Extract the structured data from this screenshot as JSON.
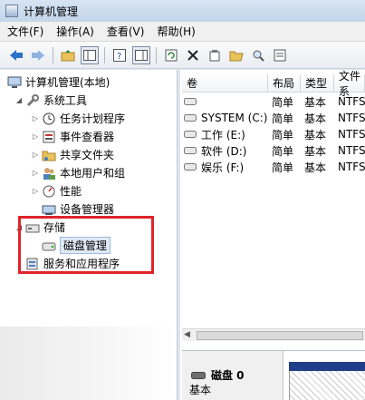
{
  "window": {
    "title": "计算机管理"
  },
  "menu": [
    "文件(F)",
    "操作(A)",
    "查看(V)",
    "帮助(H)"
  ],
  "toolbar_icons": [
    "back-arrow-icon",
    "forward-arrow-icon",
    "folder-up-icon",
    "show-tree-icon",
    "help-icon",
    "show-pane-icon",
    "refresh-icon",
    "delete-icon",
    "properties-icon",
    "open-folder-icon",
    "search-icon",
    "export-icon"
  ],
  "tree": {
    "root": "计算机管理(本地)",
    "system_tools": "系统工具",
    "task_scheduler": "任务计划程序",
    "event_viewer": "事件查看器",
    "shared_folders": "共享文件夹",
    "local_users": "本地用户和组",
    "performance": "性能",
    "device_manager": "设备管理器",
    "storage": "存储",
    "disk_management": "磁盘管理",
    "services_apps": "服务和应用程序"
  },
  "volume_table": {
    "columns": [
      "卷",
      "布局",
      "类型",
      "文件系"
    ],
    "rows": [
      {
        "name": "",
        "layout": "简单",
        "type": "基本",
        "fs": "NTFS"
      },
      {
        "name": "SYSTEM (C:)",
        "layout": "简单",
        "type": "基本",
        "fs": "NTFS"
      },
      {
        "name": "工作 (E:)",
        "layout": "简单",
        "type": "基本",
        "fs": "NTFS"
      },
      {
        "name": "软件 (D:)",
        "layout": "简单",
        "type": "基本",
        "fs": "NTFS"
      },
      {
        "name": "娱乐 (F:)",
        "layout": "简单",
        "type": "基本",
        "fs": "NTFS"
      }
    ]
  },
  "disk_panel": {
    "name": "磁盘 0",
    "type": "基本"
  },
  "colors": {
    "highlight_box": "#e0242a",
    "partition_bar": "#1f3f8a"
  }
}
